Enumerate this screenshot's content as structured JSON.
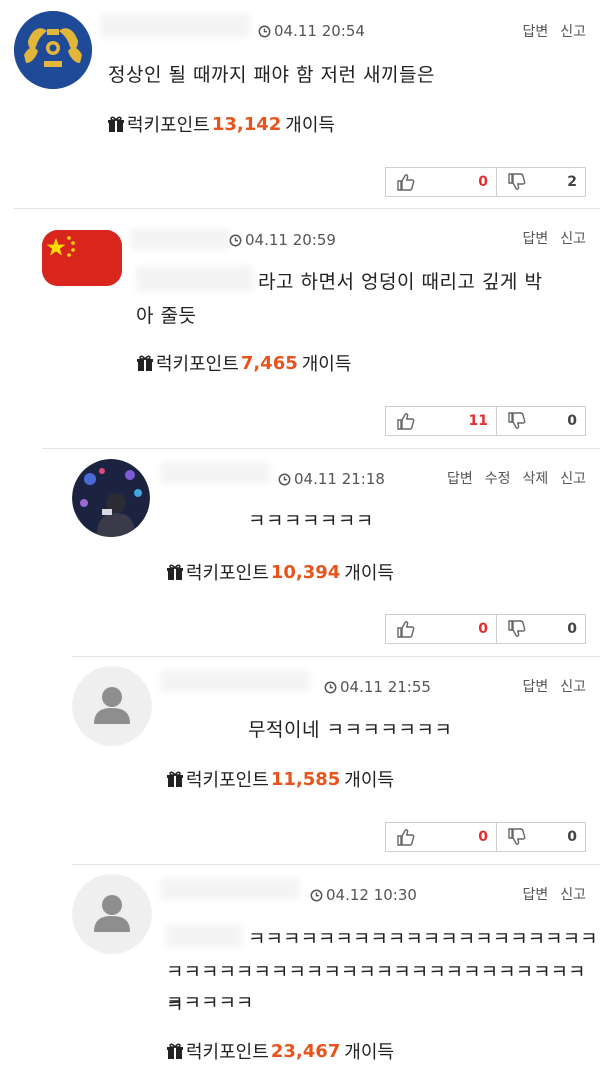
{
  "labels": {
    "reply": "답변",
    "report": "신고",
    "edit": "수정",
    "delete": "삭제",
    "points_prefix": "럭키포인트",
    "points_suffix": "개이득"
  },
  "comments": [
    {
      "time": "04.11 20:54",
      "text": "정상인 될 때까지 패야 함 저런 새끼들은",
      "points": "13,142",
      "upvotes": "0",
      "downvotes": "2"
    },
    {
      "time": "04.11 20:59",
      "text": "라고 하면서 엉덩이 때리고 깊게 박",
      "text2": "아 줄듯",
      "points": "7,465",
      "upvotes": "11",
      "downvotes": "0"
    },
    {
      "time": "04.11 21:18",
      "text": "ㅋㅋㅋㅋㅋㅋㅋ",
      "points": "10,394",
      "upvotes": "0",
      "downvotes": "0"
    },
    {
      "time": "04.11 21:55",
      "text": "무적이네 ㅋㅋㅋㅋㅋㅋㅋ",
      "points": "11,585",
      "upvotes": "0",
      "downvotes": "0"
    },
    {
      "time": "04.12 10:30",
      "text": "ㅋㅋㅋㅋㅋㅋㅋㅋㅋㅋㅋㅋㅋㅋㅋㅋㅋㅋㅋㅋ",
      "text2": "ㅋㅋㅋㅋㅋㅋㅋㅋㅋㅋㅋㅋㅋㅋㅋㅋㅋㅋㅋㅋㅋㅋㅋㅋㅋ",
      "text3": "ㅋㅋㅋㅋㅋ",
      "points": "23,467"
    }
  ],
  "icons": {
    "clock": "clock-icon",
    "gift": "gift-icon",
    "thumb_up": "thumbs-up-icon",
    "thumb_down": "thumbs-down-icon",
    "default_avatar": "default-avatar-icon"
  },
  "colors": {
    "points_accent": "#e8541c",
    "upvote_count": "#e03030",
    "separator": "#e3e3e3"
  }
}
